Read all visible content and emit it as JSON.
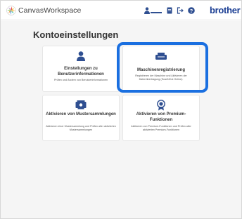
{
  "header": {
    "app_name": "CanvasWorkspace",
    "brand": "brother",
    "icons": [
      "user-icon",
      "document-icon",
      "logout-icon",
      "help-icon"
    ]
  },
  "page": {
    "title": "Kontoeinstellungen"
  },
  "cards": [
    {
      "title": "Einstellungen zu Benutzerinformationen",
      "description": "Prüfen und Ändern von Benutzerinformationen",
      "icon": "user-icon"
    },
    {
      "title": "Maschinenregistrierung",
      "description": "Registrieren der Maschine und Aktivieren der Datenübertragung (ScanNCut Online).",
      "icon": "machine-icon"
    },
    {
      "title": "Aktivieren von Mustersammlungen",
      "description": "Aktivieren einer Mustersammlung und Prüfen aller aktivierten Mustersammlungen",
      "icon": "pattern-collection-icon"
    },
    {
      "title": "Aktivieren von Premium-Funktionen",
      "description": "Aktivieren von Premium-Funktionen und Prüfen aller aktivierten Premium-Funktionen",
      "icon": "premium-badge-icon"
    }
  ],
  "colors": {
    "brand": "#1c3f94",
    "icon": "#2f4f91",
    "highlight": "#1a6fe0",
    "background": "#f5f5f5"
  }
}
